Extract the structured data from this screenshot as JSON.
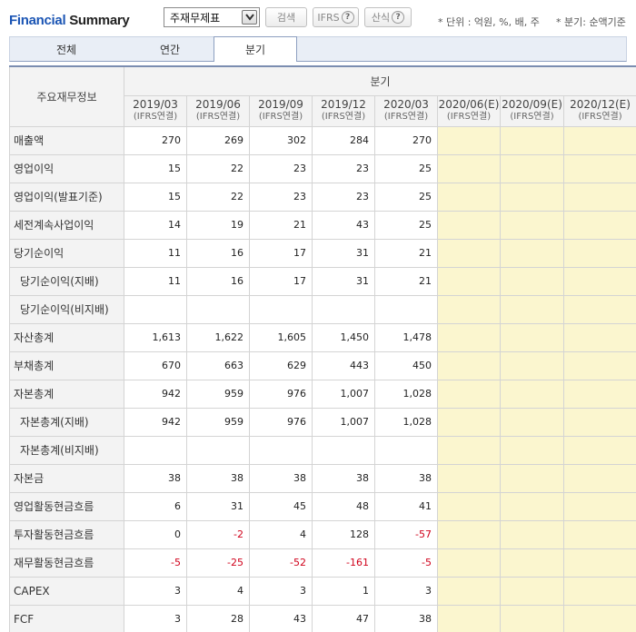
{
  "logo": {
    "part1": "Financial",
    "part2": " Summary"
  },
  "toolbar": {
    "select_value": "주재무제표",
    "search_label": "검색",
    "ifrs_label": "IFRS",
    "calc_label": "산식",
    "help_glyph": "?",
    "unit_note": "* 단위 : 억원, %, 배, 주",
    "quarter_note": "* 분기: 순액기준"
  },
  "tabs": [
    {
      "label": "전체"
    },
    {
      "label": "연간"
    },
    {
      "label": "분기"
    }
  ],
  "table": {
    "corner_label": "주요재무정보",
    "group_label": "분기",
    "columns": [
      {
        "period": "2019/03",
        "basis": "(IFRS연결)"
      },
      {
        "period": "2019/06",
        "basis": "(IFRS연결)"
      },
      {
        "period": "2019/09",
        "basis": "(IFRS연결)"
      },
      {
        "period": "2019/12",
        "basis": "(IFRS연결)"
      },
      {
        "period": "2020/03",
        "basis": "(IFRS연결)"
      },
      {
        "period": "2020/06(E)",
        "basis": "(IFRS연결)"
      },
      {
        "period": "2020/09(E)",
        "basis": "(IFRS연결)"
      },
      {
        "period": "2020/12(E)",
        "basis": "(IFRS연결)"
      }
    ],
    "rows": [
      {
        "label": "매출액",
        "values": [
          "270",
          "269",
          "302",
          "284",
          "270"
        ]
      },
      {
        "label": "영업이익",
        "values": [
          "15",
          "22",
          "23",
          "23",
          "25"
        ]
      },
      {
        "label": "영업이익(발표기준)",
        "values": [
          "15",
          "22",
          "23",
          "23",
          "25"
        ]
      },
      {
        "label": "세전계속사업이익",
        "values": [
          "14",
          "19",
          "21",
          "43",
          "25"
        ]
      },
      {
        "label": "당기순이익",
        "values": [
          "11",
          "16",
          "17",
          "31",
          "21"
        ]
      },
      {
        "label": "당기순이익(지배)",
        "values": [
          "11",
          "16",
          "17",
          "31",
          "21"
        ]
      },
      {
        "label": "당기순이익(비지배)",
        "values": [
          "",
          "",
          "",
          "",
          ""
        ]
      },
      {
        "label": "자산총계",
        "values": [
          "1,613",
          "1,622",
          "1,605",
          "1,450",
          "1,478"
        ]
      },
      {
        "label": "부채총계",
        "values": [
          "670",
          "663",
          "629",
          "443",
          "450"
        ]
      },
      {
        "label": "자본총계",
        "values": [
          "942",
          "959",
          "976",
          "1,007",
          "1,028"
        ]
      },
      {
        "label": "자본총계(지배)",
        "values": [
          "942",
          "959",
          "976",
          "1,007",
          "1,028"
        ]
      },
      {
        "label": "자본총계(비지배)",
        "values": [
          "",
          "",
          "",
          "",
          ""
        ]
      },
      {
        "label": "자본금",
        "values": [
          "38",
          "38",
          "38",
          "38",
          "38"
        ]
      },
      {
        "label": "영업활동현금흐름",
        "values": [
          "6",
          "31",
          "45",
          "48",
          "41"
        ]
      },
      {
        "label": "투자활동현금흐름",
        "values": [
          "0",
          "-2",
          "4",
          "128",
          "-57"
        ]
      },
      {
        "label": "재무활동현금흐름",
        "values": [
          "-5",
          "-25",
          "-52",
          "-161",
          "-5"
        ]
      },
      {
        "label": "CAPEX",
        "values": [
          "3",
          "4",
          "3",
          "1",
          "3"
        ]
      },
      {
        "label": "FCF",
        "values": [
          "3",
          "28",
          "43",
          "47",
          "38"
        ]
      }
    ]
  },
  "colors": {
    "negative": "#d0021b",
    "estimate_bg": "#fbf6cf",
    "logo_blue": "#1b55b4"
  }
}
